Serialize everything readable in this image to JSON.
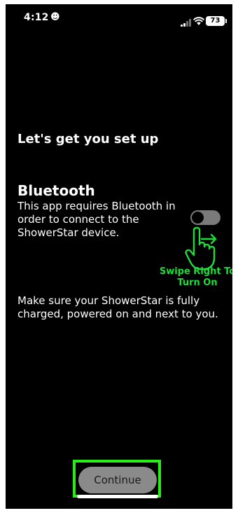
{
  "status_bar": {
    "time": "4:12",
    "time_emoji": "☻",
    "signal": "signal-icon",
    "wifi": "wifi-icon",
    "battery_level": "73"
  },
  "setup": {
    "title": "Let's get you set up",
    "bluetooth": {
      "heading": "Bluetooth",
      "description": "This app requires Bluetooth in order to connect to the ShowerStar device.",
      "toggle_on": false
    },
    "swipe_hint": {
      "line1": "Swipe Right To",
      "line2": "Turn On",
      "color": "#1fdc3a"
    },
    "charge_note": "Make sure your ShowerStar is fully charged, powered on and next to you."
  },
  "footer": {
    "continue_label": "Continue",
    "highlight_color": "#27ef16"
  }
}
